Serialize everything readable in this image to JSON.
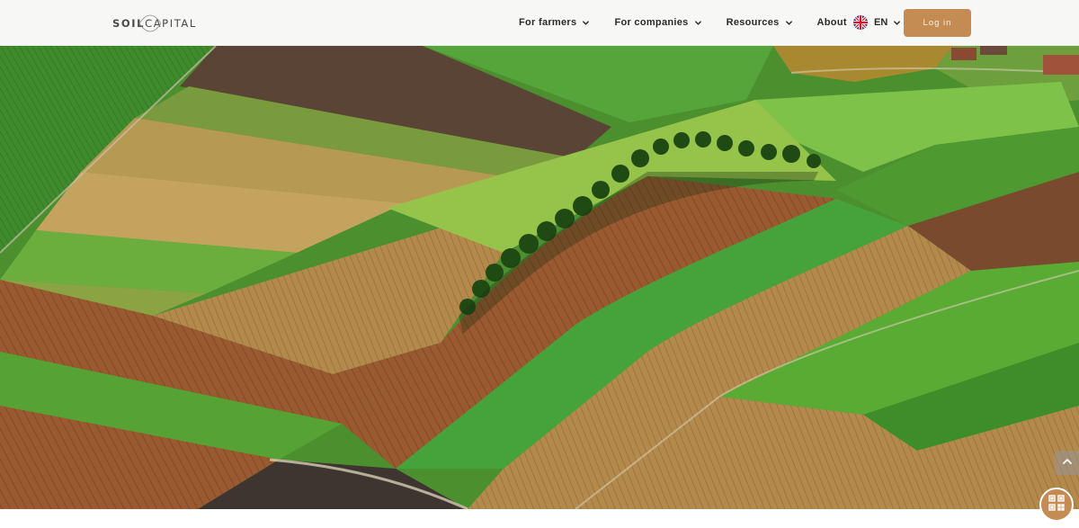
{
  "brand": {
    "logo_left": "SOIL",
    "logo_right": "CAPITAL",
    "accent_color": "#c48b52"
  },
  "nav": {
    "items": [
      {
        "label": "For farmers",
        "icon": "chevron-down-icon"
      },
      {
        "label": "For companies",
        "icon": "chevron-down-icon"
      },
      {
        "label": "Resources",
        "icon": "chevron-down-icon"
      },
      {
        "label": "About",
        "icon": "chevron-down-icon"
      }
    ]
  },
  "language": {
    "code": "EN",
    "flag_icon": "uk-flag-icon"
  },
  "auth": {
    "login_label": "Log in"
  },
  "hero": {
    "image": "aerial-farm-fields-photo"
  },
  "widgets": {
    "scroll_top_icon": "chevron-up-icon",
    "qr_icon": "qr-code-icon"
  }
}
